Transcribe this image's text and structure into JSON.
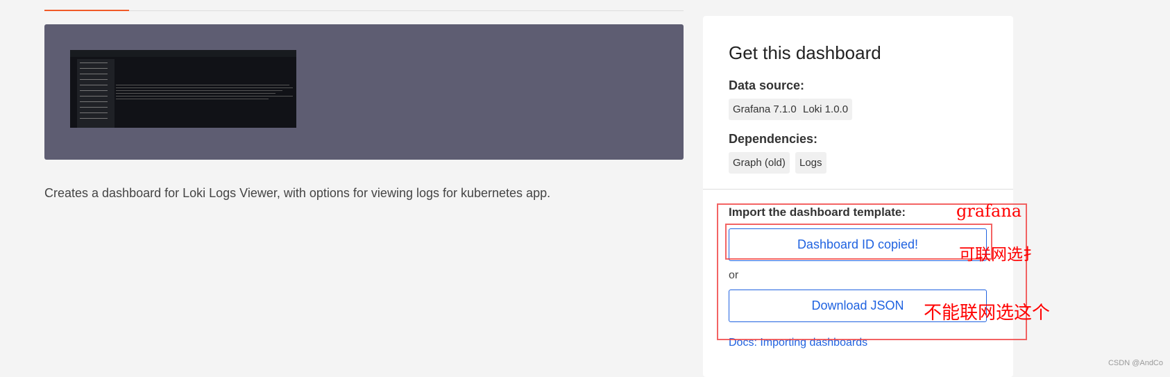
{
  "description": "Creates a dashboard for Loki Logs Viewer, with options for viewing logs for kubernetes app.",
  "card": {
    "title": "Get this dashboard",
    "data_source_label": "Data source:",
    "data_sources": [
      "Grafana 7.1.0",
      "Loki 1.0.0"
    ],
    "dependencies_label": "Dependencies:",
    "dependencies": [
      "Graph (old)",
      "Logs"
    ],
    "import_label": "Import the dashboard template:",
    "copy_id_button": "Dashboard ID copied!",
    "or": "or",
    "download_button": "Download JSON",
    "docs_link": "Docs: Importing dashboards"
  },
  "annotations": {
    "grafana": "grafana",
    "online": "可联网选扌",
    "offline": "不能联网选这个"
  },
  "watermark": "CSDN @AndCo"
}
